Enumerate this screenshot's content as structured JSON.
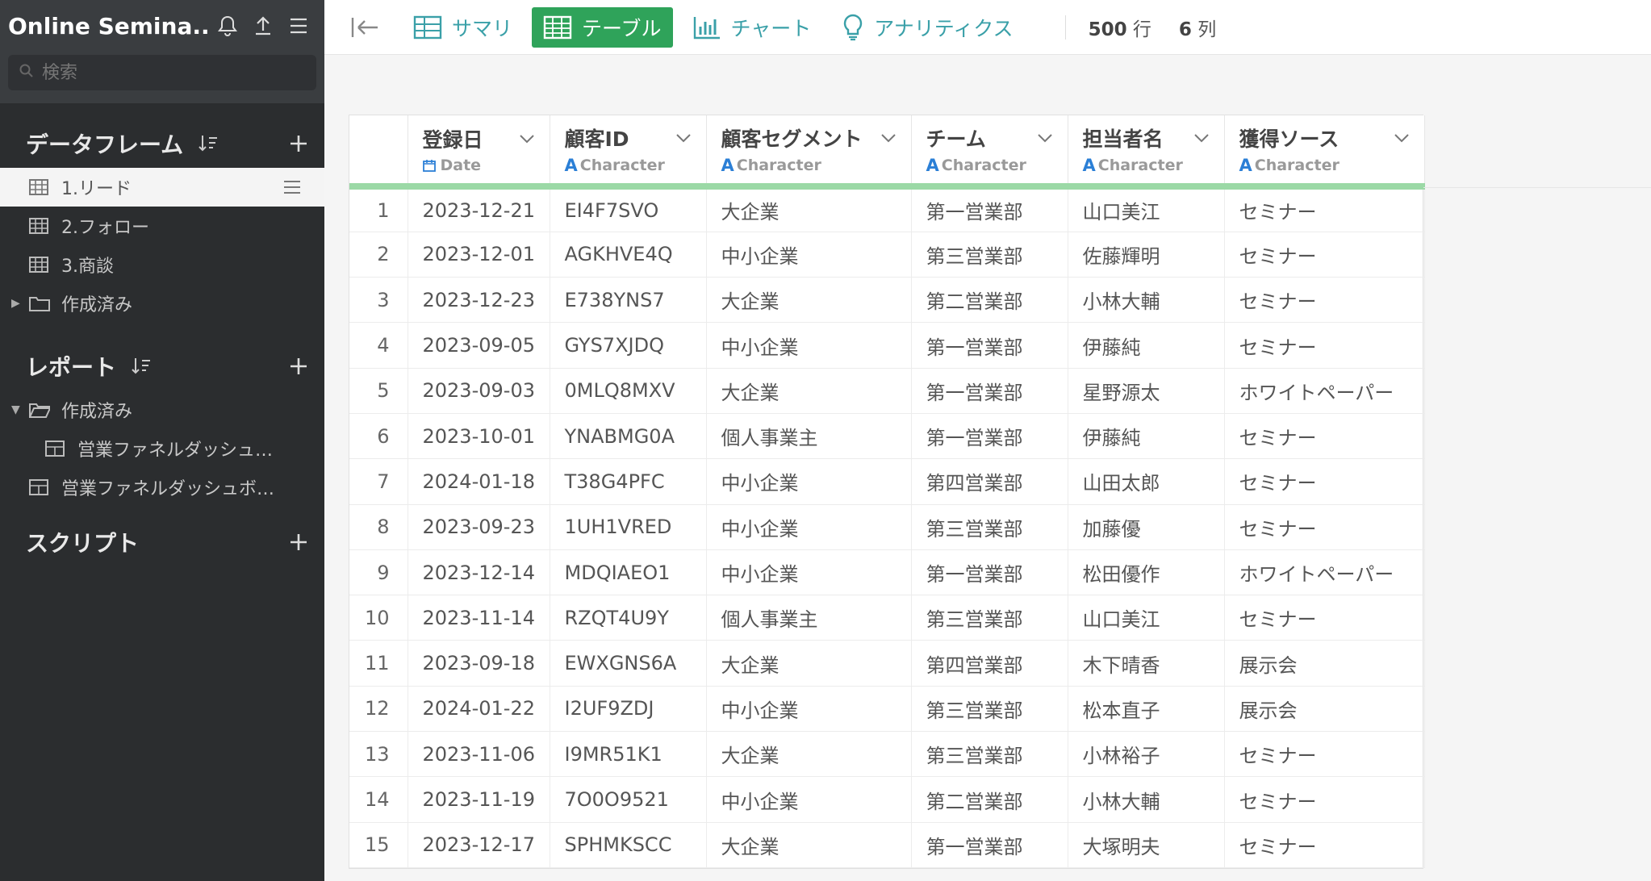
{
  "sidebar": {
    "title": "Online Semina...",
    "search_placeholder": "検索",
    "sections": {
      "dataframes": {
        "label": "データフレーム"
      },
      "reports": {
        "label": "レポート"
      },
      "scripts": {
        "label": "スクリプト"
      }
    },
    "dataframe_items": [
      {
        "label": "1.リード"
      },
      {
        "label": "2.フォロー"
      },
      {
        "label": "3.商談"
      },
      {
        "label": "作成済み"
      }
    ],
    "report_items": [
      {
        "label": "作成済み"
      },
      {
        "label": "営業ファネルダッシュ…"
      },
      {
        "label": "営業ファネルダッシュボ…"
      }
    ]
  },
  "toolbar": {
    "summary": "サマリ",
    "table": "テーブル",
    "chart": "チャート",
    "analytics": "アナリティクス",
    "rows_value": "500",
    "rows_unit": "行",
    "cols_value": "6",
    "cols_unit": "列"
  },
  "table": {
    "columns": [
      {
        "name": "登録日",
        "type": "Date"
      },
      {
        "name": "顧客ID",
        "type": "Character"
      },
      {
        "name": "顧客セグメント",
        "type": "Character"
      },
      {
        "name": "チーム",
        "type": "Character"
      },
      {
        "name": "担当者名",
        "type": "Character"
      },
      {
        "name": "獲得ソース",
        "type": "Character"
      }
    ],
    "rows": [
      [
        "1",
        "2023-12-21",
        "EI4F7SVO",
        "大企業",
        "第一営業部",
        "山口美江",
        "セミナー"
      ],
      [
        "2",
        "2023-12-01",
        "AGKHVE4Q",
        "中小企業",
        "第三営業部",
        "佐藤輝明",
        "セミナー"
      ],
      [
        "3",
        "2023-12-23",
        "E738YNS7",
        "大企業",
        "第二営業部",
        "小林大輔",
        "セミナー"
      ],
      [
        "4",
        "2023-09-05",
        "GYS7XJDQ",
        "中小企業",
        "第一営業部",
        "伊藤純",
        "セミナー"
      ],
      [
        "5",
        "2023-09-03",
        "0MLQ8MXV",
        "大企業",
        "第一営業部",
        "星野源太",
        "ホワイトペーパー"
      ],
      [
        "6",
        "2023-10-01",
        "YNABMG0A",
        "個人事業主",
        "第一営業部",
        "伊藤純",
        "セミナー"
      ],
      [
        "7",
        "2024-01-18",
        "T38G4PFC",
        "中小企業",
        "第四営業部",
        "山田太郎",
        "セミナー"
      ],
      [
        "8",
        "2023-09-23",
        "1UH1VRED",
        "中小企業",
        "第三営業部",
        "加藤優",
        "セミナー"
      ],
      [
        "9",
        "2023-12-14",
        "MDQIAEO1",
        "中小企業",
        "第一営業部",
        "松田優作",
        "ホワイトペーパー"
      ],
      [
        "10",
        "2023-11-14",
        "RZQT4U9Y",
        "個人事業主",
        "第三営業部",
        "山口美江",
        "セミナー"
      ],
      [
        "11",
        "2023-09-18",
        "EWXGNS6A",
        "大企業",
        "第四営業部",
        "木下晴香",
        "展示会"
      ],
      [
        "12",
        "2024-01-22",
        "I2UF9ZDJ",
        "中小企業",
        "第三営業部",
        "松本直子",
        "展示会"
      ],
      [
        "13",
        "2023-11-06",
        "I9MR51K1",
        "大企業",
        "第三営業部",
        "小林裕子",
        "セミナー"
      ],
      [
        "14",
        "2023-11-19",
        "7O0O9521",
        "中小企業",
        "第二営業部",
        "小林大輔",
        "セミナー"
      ],
      [
        "15",
        "2023-12-17",
        "SPHMKSCC",
        "大企業",
        "第一営業部",
        "大塚明夫",
        "セミナー"
      ]
    ]
  },
  "colors": {
    "accent_green": "#2fa35a",
    "header_underline": "#9bd9a6",
    "type_icon_blue": "#2b7fd6",
    "toolbar_text": "#3aa0a8"
  }
}
